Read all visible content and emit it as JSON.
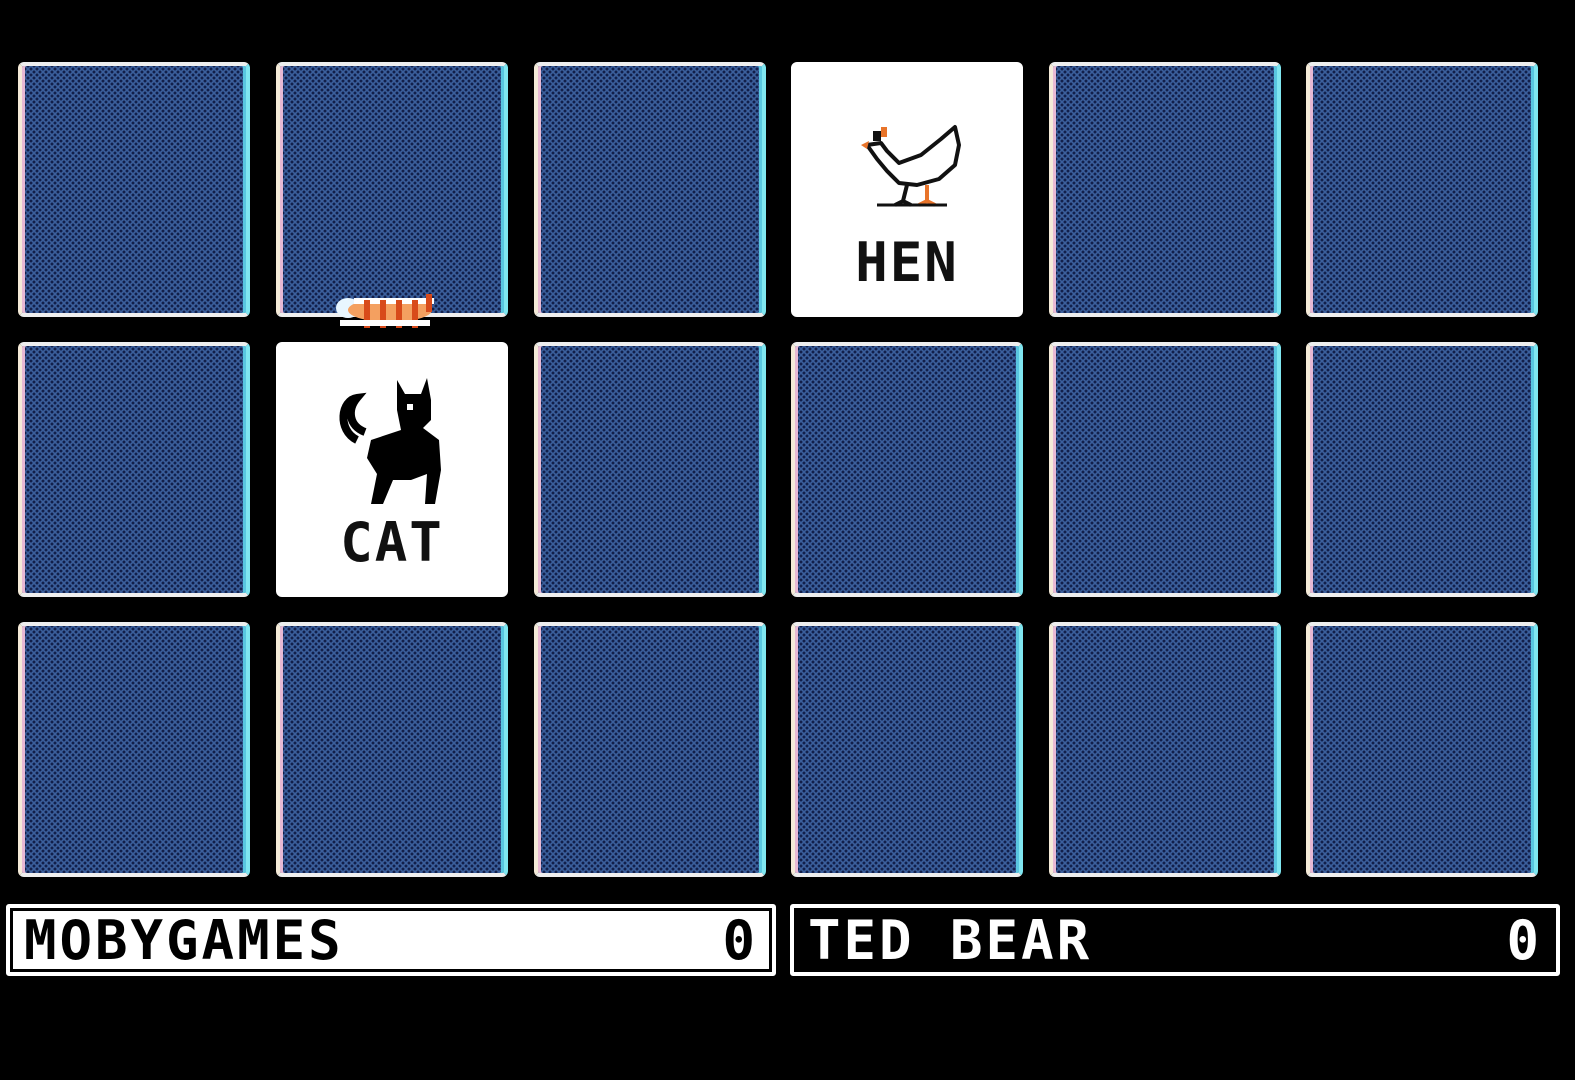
{
  "board": {
    "rows": 3,
    "cols": 6,
    "revealed": [
      {
        "row": 0,
        "col": 3,
        "label": "HEN",
        "icon": "hen-icon"
      },
      {
        "row": 1,
        "col": 1,
        "label": "CAT",
        "icon": "cat-icon"
      }
    ]
  },
  "players": [
    {
      "name": "MOBYGAMES",
      "score": "0",
      "active": true
    },
    {
      "name": "TED BEAR",
      "score": "0",
      "active": false
    }
  ],
  "cursor": {
    "icon": "striped-cat-cursor-icon"
  },
  "colors": {
    "card_back": "#3b5f9c",
    "card_face": "#ffffff",
    "background": "#000000",
    "accent_cyan": "#7fe6f0",
    "accent_orange": "#e8742a"
  }
}
